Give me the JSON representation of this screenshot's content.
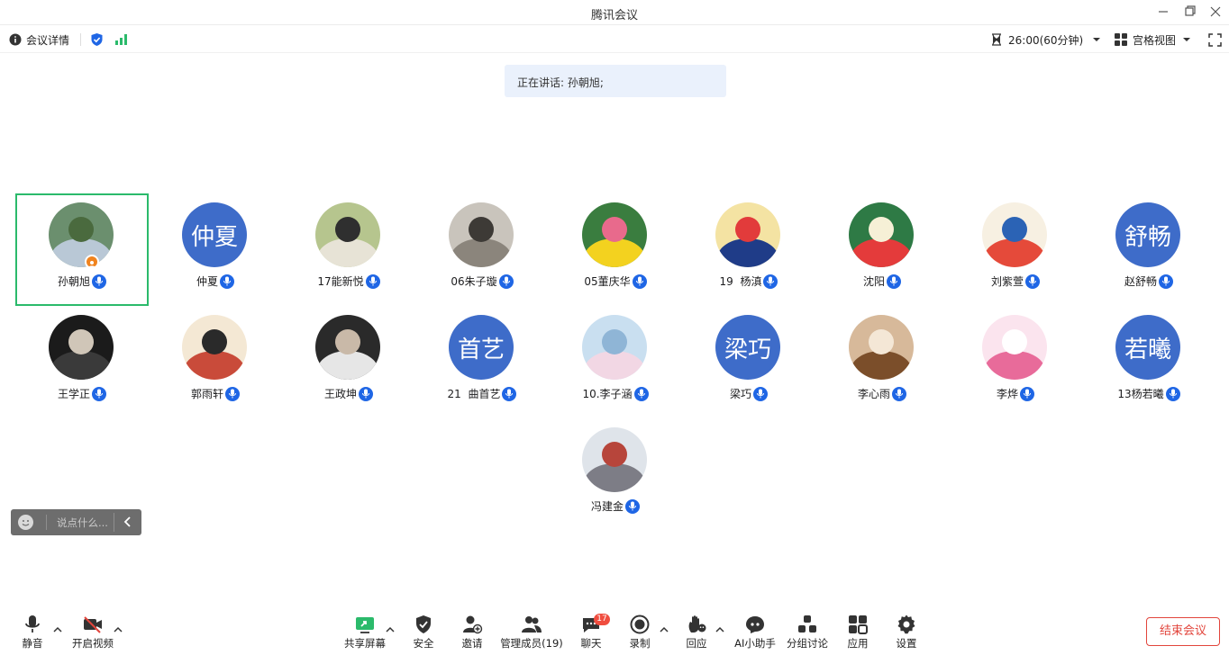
{
  "window": {
    "title": "腾讯会议"
  },
  "toolbar": {
    "meeting_details": "会议详情",
    "timer": "26:00(60分钟)",
    "view_mode": "宫格视图"
  },
  "speaking": {
    "text": "正在讲话: 孙朝旭;"
  },
  "participants": [
    {
      "name": "孙朝旭",
      "avatar_text": "",
      "host": true,
      "active": true
    },
    {
      "name": "仲夏",
      "avatar_text": "仲夏"
    },
    {
      "name": "17能新悦",
      "avatar_text": ""
    },
    {
      "name": "06朱子璇",
      "avatar_text": ""
    },
    {
      "name": "05董庆华",
      "avatar_text": ""
    },
    {
      "name": "19  杨滇",
      "avatar_text": ""
    },
    {
      "name": "沈阳",
      "avatar_text": ""
    },
    {
      "name": "刘紫萱",
      "avatar_text": ""
    },
    {
      "name": "赵舒畅",
      "avatar_text": "舒畅"
    },
    {
      "name": "王学正",
      "avatar_text": ""
    },
    {
      "name": "郭雨轩",
      "avatar_text": ""
    },
    {
      "name": "王政坤",
      "avatar_text": ""
    },
    {
      "name": "21  曲首艺",
      "avatar_text": "首艺"
    },
    {
      "name": "10.李子涵",
      "avatar_text": ""
    },
    {
      "name": "梁巧",
      "avatar_text": "梁巧"
    },
    {
      "name": "李心雨",
      "avatar_text": ""
    },
    {
      "name": "李烨",
      "avatar_text": ""
    },
    {
      "name": "13杨若曦",
      "avatar_text": "若曦"
    },
    {
      "name": "冯建金",
      "avatar_text": ""
    }
  ],
  "chat": {
    "placeholder": "说点什么..."
  },
  "bottom": {
    "mute": "静音",
    "video": "开启视频",
    "share": "共享屏幕",
    "security": "安全",
    "invite": "邀请",
    "members": "管理成员(19)",
    "chat": "聊天",
    "chat_badge": "17",
    "record": "录制",
    "reactions": "回应",
    "ai": "AI小助手",
    "breakout": "分组讨论",
    "apps": "应用",
    "settings": "设置",
    "end": "结束会议"
  },
  "colors": {
    "accent": "#1f66e5",
    "active_border": "#2bba6b",
    "end": "#e2453c",
    "avatar_bg": "#3e6cc9"
  }
}
